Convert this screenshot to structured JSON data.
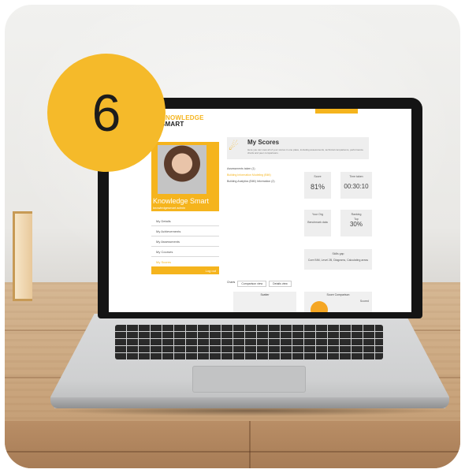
{
  "badge": {
    "number": "6",
    "color": "#f5ba2a"
  },
  "app": {
    "logo_line1": "KNOWLEDGE",
    "logo_line2": "SMART",
    "brand_color": "#f5b41d"
  },
  "profile": {
    "name": "Knowledge Smart",
    "role": "knowledgesmart admin"
  },
  "menu": {
    "items": [
      {
        "label": "My Details"
      },
      {
        "label": "My Achievements"
      },
      {
        "label": "My Assessments"
      },
      {
        "label": "My Courses"
      },
      {
        "label": "My Scores"
      }
    ],
    "logout_label": "Log out"
  },
  "header": {
    "title": "My Scores",
    "description": "Here you can view all of your scores in one place, including assessments, technical comparisons, performance charts and peer comparisons."
  },
  "assessments": {
    "heading": "Assessments taken (1)",
    "link": "Building Information Modeling (BIM)",
    "row": "Building Analytics (BIM) Information (2)"
  },
  "stats": {
    "score_label": "Score",
    "score_value": "81%",
    "time_label": "Time taken",
    "time_value": "00:30:10",
    "avg_label": "Your Org",
    "avg_value": "Benchmark data",
    "ranking_label": "Ranking",
    "ranking_top": "Top",
    "ranking_value": "30%",
    "skills_label": "Skills gap",
    "skills_value": "Core BIM, Level 2B, Diagrams, Calculating areas"
  },
  "tabs": [
    "Charts",
    "Comparison view",
    "Details view"
  ],
  "panels": {
    "scatter_label": "Scatter",
    "compare_label": "Score Comparison",
    "legend_label": "Scored"
  }
}
